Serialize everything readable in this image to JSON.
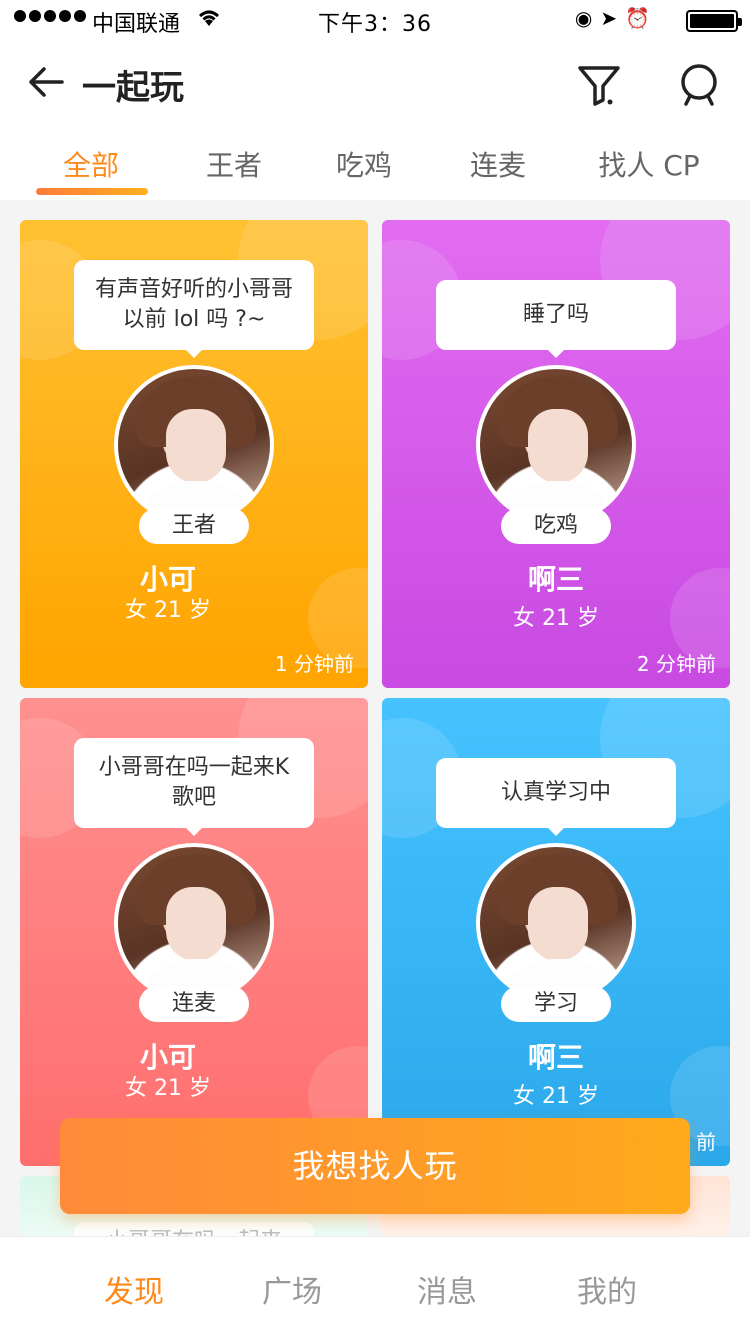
{
  "status_bar": {
    "carrier": "中国联通",
    "time": "下午3：36"
  },
  "nav": {
    "title": "一起玩"
  },
  "tabs": [
    {
      "label": "全部",
      "active": true
    },
    {
      "label": "王者",
      "active": false
    },
    {
      "label": "吃鸡",
      "active": false
    },
    {
      "label": "连麦",
      "active": false
    },
    {
      "label": "找人 CP",
      "active": false
    }
  ],
  "cards": [
    {
      "message": "有声音好听的小哥哥以前 lol 吗 ?~",
      "game": "王者",
      "name": "小可",
      "meta": "女 21 岁",
      "time": "1 分钟前"
    },
    {
      "message": "睡了吗",
      "game": "吃鸡",
      "name": "啊三",
      "meta": "女 21 岁",
      "time": "2 分钟前"
    },
    {
      "message": "小哥哥在吗一起来K 歌吧",
      "game": "连麦",
      "name": "小可",
      "meta": "女 21 岁",
      "time": ""
    },
    {
      "message": "认真学习中",
      "game": "学习",
      "name": "啊三",
      "meta": "女 21 岁",
      "time": "前"
    }
  ],
  "partial_card": {
    "message": "小哥哥在吗一起来"
  },
  "cta": {
    "label": "我想找人玩"
  },
  "bottom_tabs": [
    {
      "label": "发现",
      "active": true
    },
    {
      "label": "广场",
      "active": false
    },
    {
      "label": "消息",
      "active": false
    },
    {
      "label": "我的",
      "active": false
    }
  ],
  "colors": {
    "accent": "#ff8a1c",
    "card_yellow": "#ffa400",
    "card_purple": "#c84ae2",
    "card_red": "#ff6e6e",
    "card_blue": "#2aa8ea"
  }
}
